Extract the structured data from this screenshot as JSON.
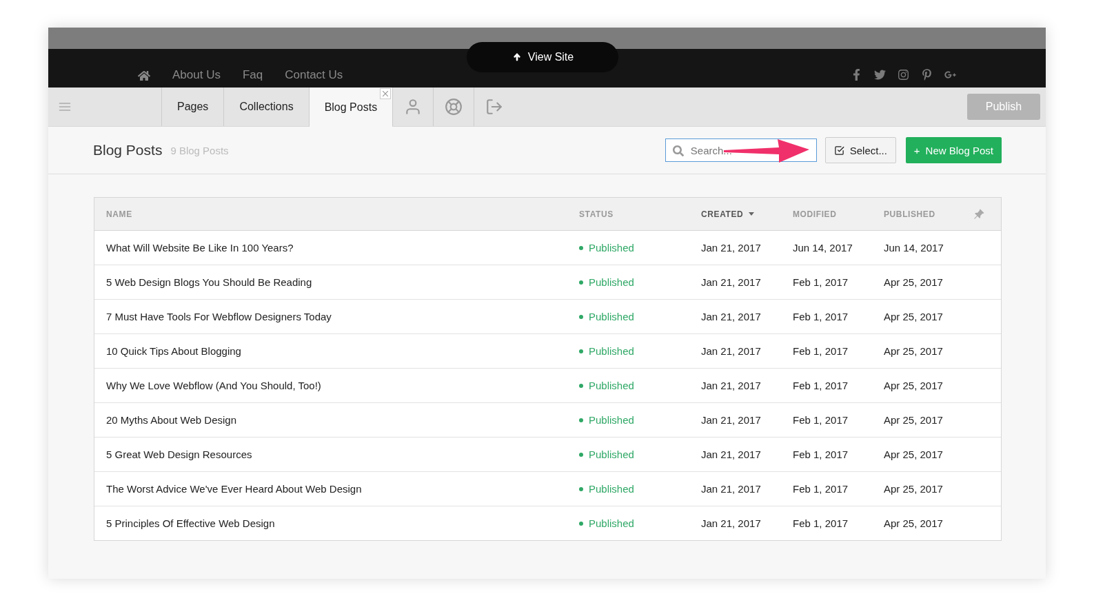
{
  "view_site": {
    "label": "View Site"
  },
  "site_nav": {
    "links": [
      "About Us",
      "Faq",
      "Contact Us"
    ]
  },
  "editor_tabs": [
    {
      "label": "Pages",
      "selected": false
    },
    {
      "label": "Collections",
      "selected": false
    },
    {
      "label": "Blog Posts",
      "selected": true
    }
  ],
  "publish_button": {
    "label": "Publish",
    "disabled": true
  },
  "header": {
    "title": "Blog Posts",
    "count": "9 Blog Posts",
    "search": {
      "placeholder": "Search..."
    },
    "select_button": "Select...",
    "new_button": {
      "icon": "+",
      "label": "New Blog Post"
    }
  },
  "table": {
    "columns": [
      {
        "label": "NAME",
        "sorted": false
      },
      {
        "label": "STATUS",
        "sorted": false
      },
      {
        "label": "CREATED",
        "sorted": true
      },
      {
        "label": "MODIFIED",
        "sorted": false
      },
      {
        "label": "PUBLISHED",
        "sorted": false
      }
    ],
    "rows": [
      {
        "name": "What Will Website Be Like In 100 Years?",
        "status": "Published",
        "color": "#2fa866",
        "created": "Jan 21, 2017",
        "modified": "Jun 14, 2017",
        "published": "Jun 14, 2017"
      },
      {
        "name": "5 Web Design Blogs You Should Be Reading",
        "status": "Published",
        "color": "#2fa866",
        "created": "Jan 21, 2017",
        "modified": "Feb 1, 2017",
        "published": "Apr 25, 2017"
      },
      {
        "name": "7 Must Have Tools For Webflow Designers Today",
        "status": "Published",
        "color": "#2fa866",
        "created": "Jan 21, 2017",
        "modified": "Feb 1, 2017",
        "published": "Apr 25, 2017"
      },
      {
        "name": "10 Quick Tips About Blogging",
        "status": "Published",
        "color": "#2fa866",
        "created": "Jan 21, 2017",
        "modified": "Feb 1, 2017",
        "published": "Apr 25, 2017"
      },
      {
        "name": "Why We Love Webflow (And You Should, Too!)",
        "status": "Published",
        "color": "#2fa866",
        "created": "Jan 21, 2017",
        "modified": "Feb 1, 2017",
        "published": "Apr 25, 2017"
      },
      {
        "name": "20 Myths About Web Design",
        "status": "Published",
        "color": "#2fa866",
        "created": "Jan 21, 2017",
        "modified": "Feb 1, 2017",
        "published": "Apr 25, 2017"
      },
      {
        "name": "5 Great Web Design Resources",
        "status": "Published",
        "color": "#2fa866",
        "created": "Jan 21, 2017",
        "modified": "Feb 1, 2017",
        "published": "Apr 25, 2017"
      },
      {
        "name": "The Worst Advice We've Ever Heard About Web Design",
        "status": "Published",
        "color": "#2fa866",
        "created": "Jan 21, 2017",
        "modified": "Feb 1, 2017",
        "published": "Apr 25, 2017"
      },
      {
        "name": "5 Principles Of Effective Web Design",
        "status": "Published",
        "color": "#2fa866",
        "created": "Jan 21, 2017",
        "modified": "Feb 1, 2017",
        "published": "Apr 25, 2017"
      }
    ]
  }
}
